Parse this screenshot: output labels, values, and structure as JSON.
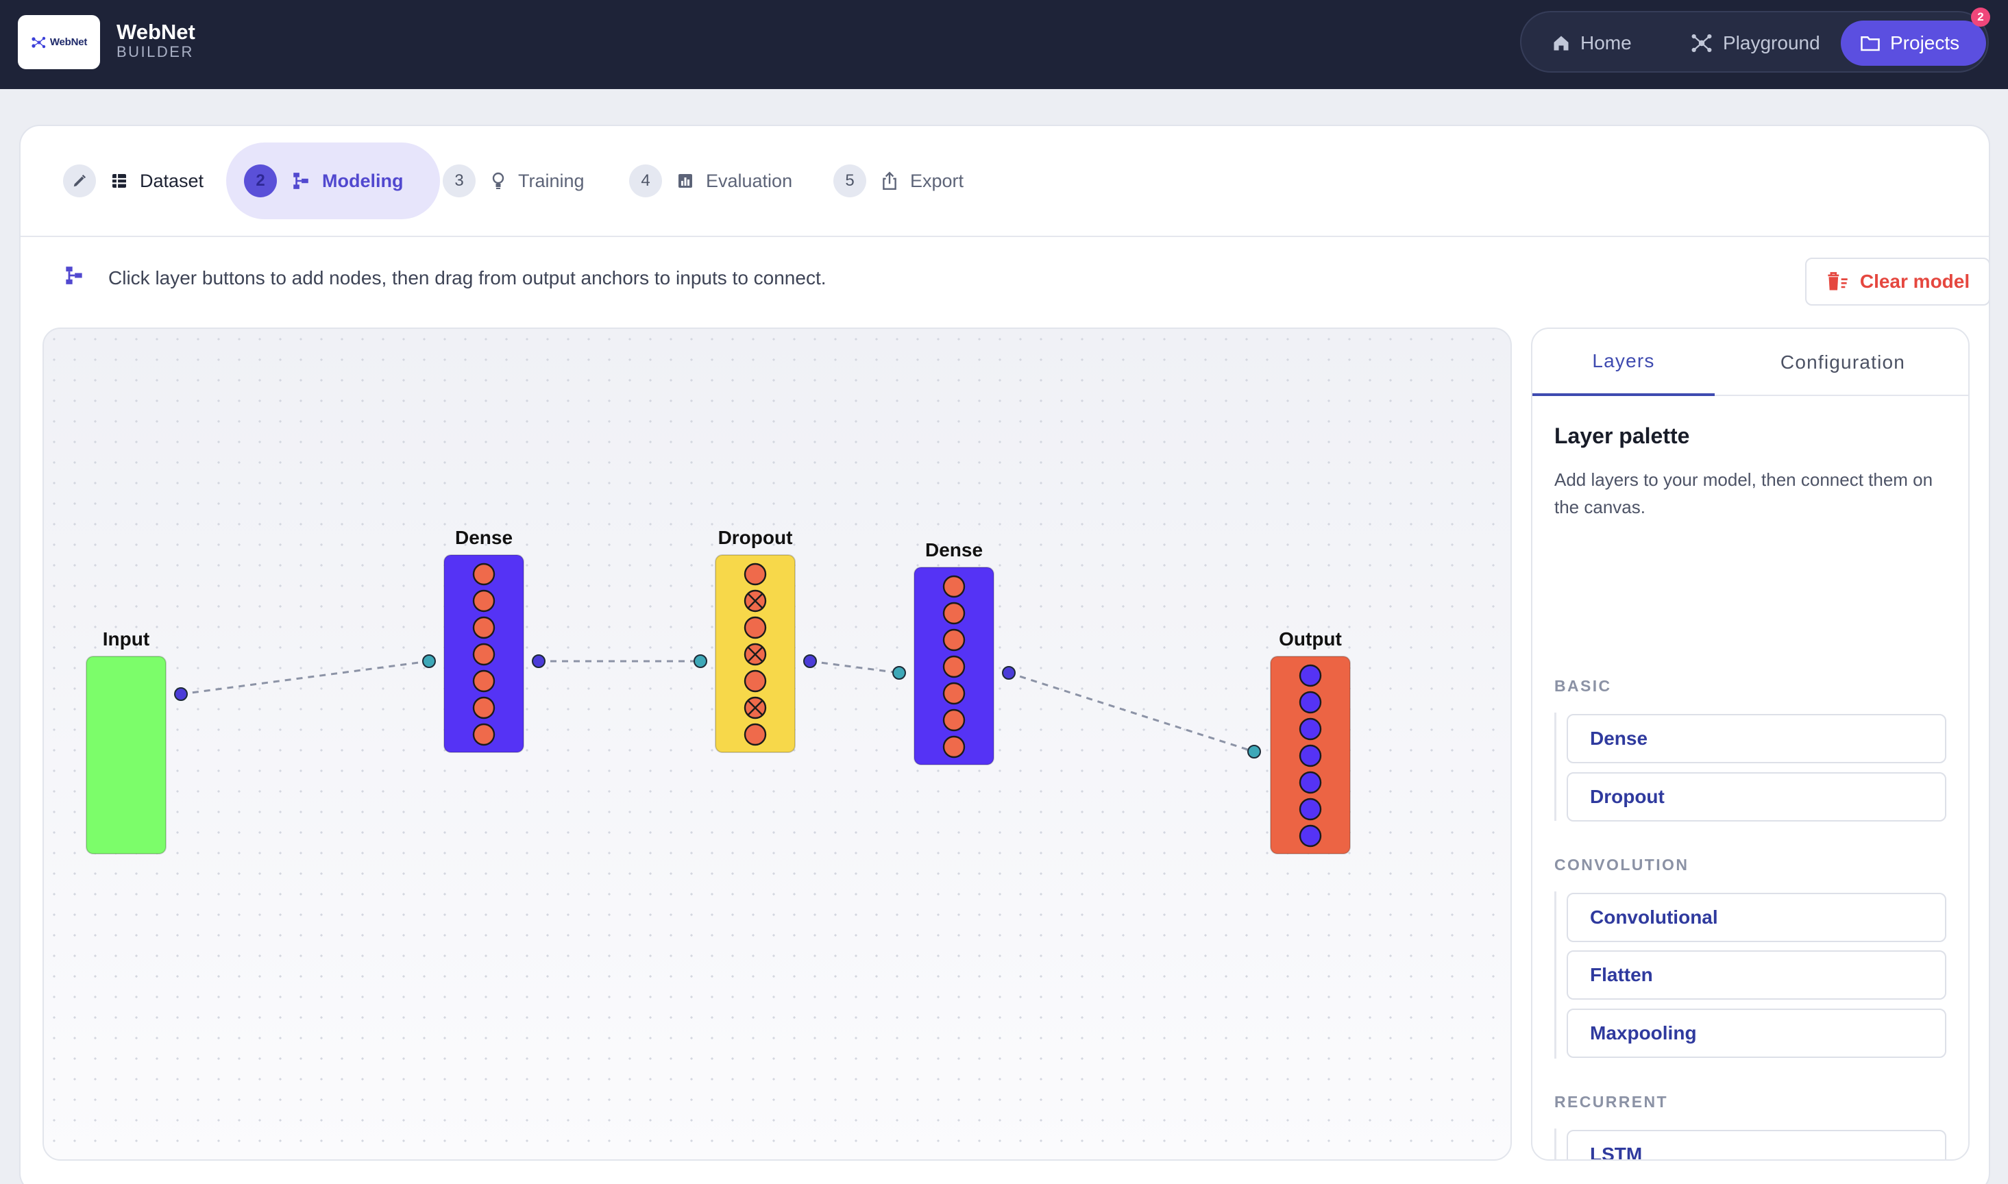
{
  "app": {
    "logo_text": "WebNet",
    "title": "WebNet",
    "subtitle": "BUILDER"
  },
  "nav": {
    "items": [
      {
        "label": "Home",
        "icon": "home-icon"
      },
      {
        "label": "Playground",
        "icon": "playground-icon"
      },
      {
        "label": "Projects",
        "icon": "folder-icon",
        "active": true
      }
    ],
    "badge_count": "2"
  },
  "steps": [
    {
      "num": "",
      "label": "Dataset",
      "icon": "table-icon",
      "state": "done"
    },
    {
      "num": "2",
      "label": "Modeling",
      "icon": "hierarchy-icon",
      "state": "active"
    },
    {
      "num": "3",
      "label": "Training",
      "icon": "lightbulb-icon",
      "state": "pending"
    },
    {
      "num": "4",
      "label": "Evaluation",
      "icon": "bar-chart-icon",
      "state": "pending"
    },
    {
      "num": "5",
      "label": "Export",
      "icon": "share-icon",
      "state": "pending"
    }
  ],
  "hint": "Click layer buttons to add nodes, then drag from output anchors to inputs to connect.",
  "clear_button": "Clear model",
  "model": {
    "nodes": [
      {
        "label": "Input",
        "type": "input",
        "color": "#7cfd6a"
      },
      {
        "label": "Dense",
        "type": "dense",
        "color": "#5533f5",
        "neurons": 7
      },
      {
        "label": "Dropout",
        "type": "dropout",
        "color": "#f7d84a",
        "neurons": 7,
        "dropped": [
          2,
          4,
          6
        ]
      },
      {
        "label": "Dense",
        "type": "dense",
        "color": "#5533f5",
        "neurons": 7
      },
      {
        "label": "Output",
        "type": "output",
        "color": "#ec6444",
        "neurons": 7
      }
    ],
    "connections": [
      [
        "Input",
        "Dense"
      ],
      [
        "Dense",
        "Dropout"
      ],
      [
        "Dropout",
        "Dense"
      ],
      [
        "Dense",
        "Output"
      ]
    ]
  },
  "panel": {
    "tabs": [
      "Layers",
      "Configuration"
    ],
    "active_tab": "Layers",
    "title": "Layer palette",
    "description": "Add layers to your model, then connect them on the canvas.",
    "groups": [
      {
        "label": "BASIC",
        "layers": [
          "Dense",
          "Dropout"
        ]
      },
      {
        "label": "CONVOLUTION",
        "layers": [
          "Convolutional",
          "Flatten",
          "Maxpooling"
        ]
      },
      {
        "label": "RECURRENT",
        "layers": [
          "LSTM"
        ]
      }
    ]
  },
  "colors": {
    "navbar": "#1e2338",
    "accent": "#5b4fe0",
    "danger": "#e5473f",
    "neuron": "#ef6a4b",
    "output_neuron": "#5533f5",
    "anchor_in": "#3ea8b8",
    "anchor_out": "#4b3cd8"
  }
}
